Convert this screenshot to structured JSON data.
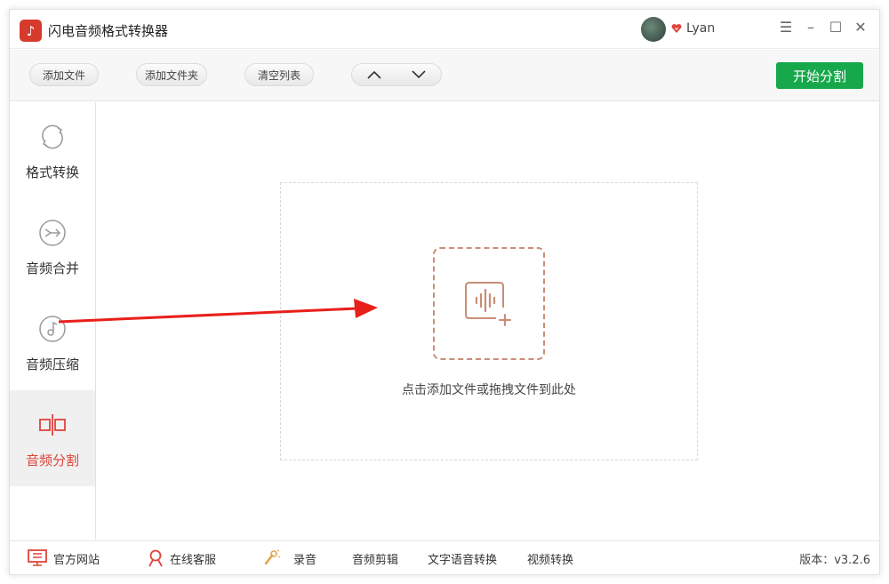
{
  "app": {
    "title": "闪电音频格式转换器",
    "logo_icon": "music-note-icon",
    "brand_color": "#d63a2c"
  },
  "user": {
    "name": "Lyan",
    "vip_icon": "vip-heart-icon"
  },
  "window_controls": {
    "menu": "☰",
    "minimize": "–",
    "maximize": "☐",
    "close": "✕"
  },
  "toolbar": {
    "add_file": "添加文件",
    "add_folder": "添加文件夹",
    "clear_list": "清空列表",
    "move_up_icon": "chevron-up-icon",
    "move_down_icon": "chevron-down-icon",
    "start": "开始分割",
    "start_color": "#16a84a"
  },
  "sidebar": {
    "items": [
      {
        "label": "格式转换",
        "icon": "refresh-icon",
        "active": false
      },
      {
        "label": "音频合并",
        "icon": "merge-icon",
        "active": false
      },
      {
        "label": "音频压缩",
        "icon": "compress-icon",
        "active": false
      },
      {
        "label": "音频分割",
        "icon": "split-icon",
        "active": true
      }
    ],
    "active_color": "#e0433a"
  },
  "main": {
    "drop_hint": "点击添加文件或拖拽文件到此处"
  },
  "footer": {
    "website": "官方网站",
    "service": "在线客服",
    "record": "录音",
    "audio_edit": "音频剪辑",
    "tts": "文字语音转换",
    "video_convert": "视频转换",
    "version": "版本：v3.2.6"
  }
}
